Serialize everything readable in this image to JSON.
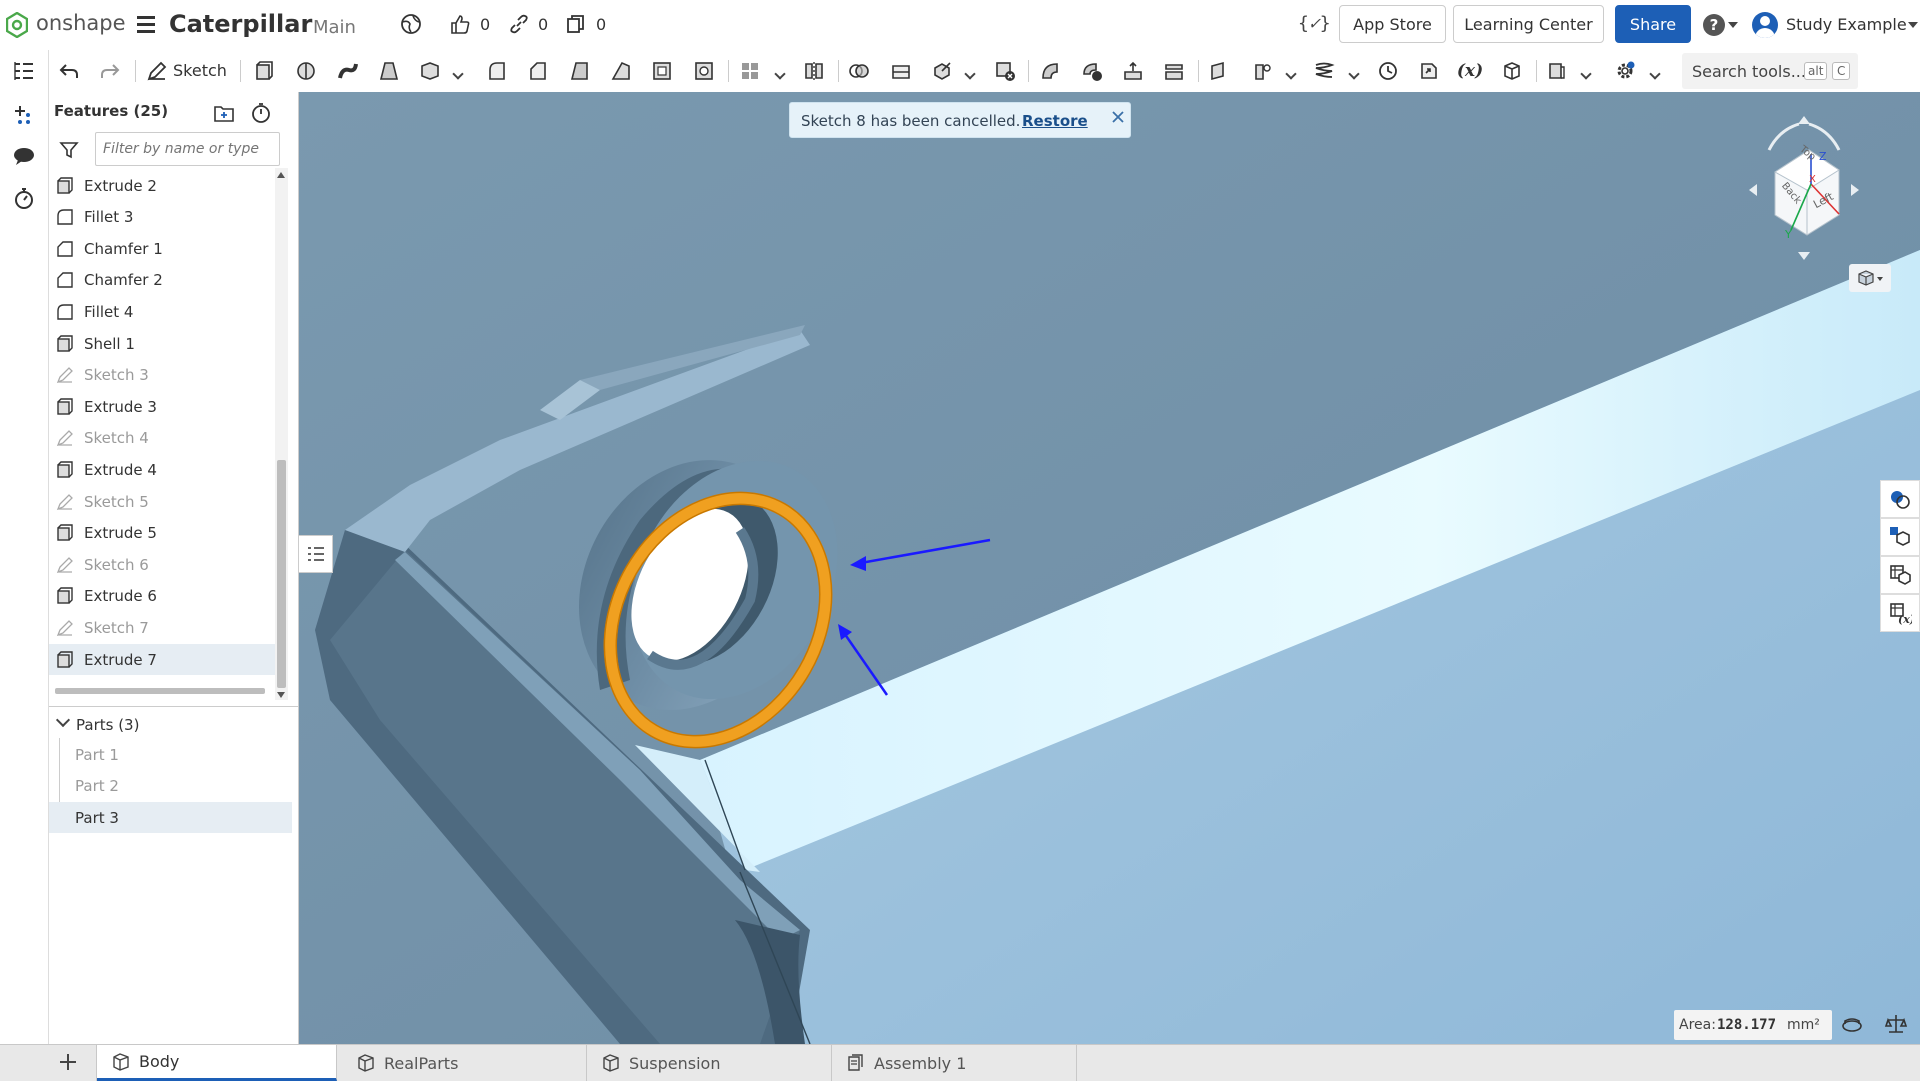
{
  "header": {
    "brand": "onshape",
    "doc_title": "Caterpillar",
    "branch": "Main",
    "likes": "0",
    "links": "0",
    "copies": "0",
    "app_store": "App Store",
    "learning_center": "Learning Center",
    "share": "Share",
    "user": "Study Example"
  },
  "toolbar": {
    "sketch_label": "Sketch",
    "search_placeholder": "Search tools...",
    "search_key1": "alt",
    "search_key2": "C"
  },
  "features": {
    "title": "Features (25)",
    "filter_placeholder": "Filter by name or type",
    "items": [
      {
        "label": "Extrude 2",
        "kind": "extrude"
      },
      {
        "label": "Fillet 3",
        "kind": "fillet"
      },
      {
        "label": "Chamfer 1",
        "kind": "chamfer"
      },
      {
        "label": "Chamfer 2",
        "kind": "chamfer"
      },
      {
        "label": "Fillet 4",
        "kind": "fillet"
      },
      {
        "label": "Shell 1",
        "kind": "extrude"
      },
      {
        "label": "Sketch 3",
        "kind": "sketch"
      },
      {
        "label": "Extrude 3",
        "kind": "extrude"
      },
      {
        "label": "Sketch 4",
        "kind": "sketch"
      },
      {
        "label": "Extrude 4",
        "kind": "extrude"
      },
      {
        "label": "Sketch 5",
        "kind": "sketch"
      },
      {
        "label": "Extrude 5",
        "kind": "extrude"
      },
      {
        "label": "Sketch 6",
        "kind": "sketch"
      },
      {
        "label": "Extrude 6",
        "kind": "extrude"
      },
      {
        "label": "Sketch 7",
        "kind": "sketch"
      },
      {
        "label": "Extrude 7",
        "kind": "extrude"
      }
    ]
  },
  "parts": {
    "title": "Parts (3)",
    "items": [
      "Part 1",
      "Part 2",
      "Part 3"
    ]
  },
  "notification": {
    "message": "Sketch 8 has been cancelled.",
    "action": "Restore"
  },
  "viewcube": {
    "top": "Top",
    "back": "Back",
    "left": "Left",
    "axis_x": "X",
    "axis_y": "Y",
    "axis_z": "Z"
  },
  "status": {
    "area_label": "Area:",
    "area_value": "128.177",
    "area_unit": "mm²"
  },
  "tabs": [
    "Body",
    "RealParts",
    "Suspension",
    "Assembly 1"
  ],
  "colors": {
    "accent": "#1d5fb6",
    "selection": "#f0a020",
    "annotation_arrow": "#1a1aff",
    "model": "#7b9ab0"
  }
}
